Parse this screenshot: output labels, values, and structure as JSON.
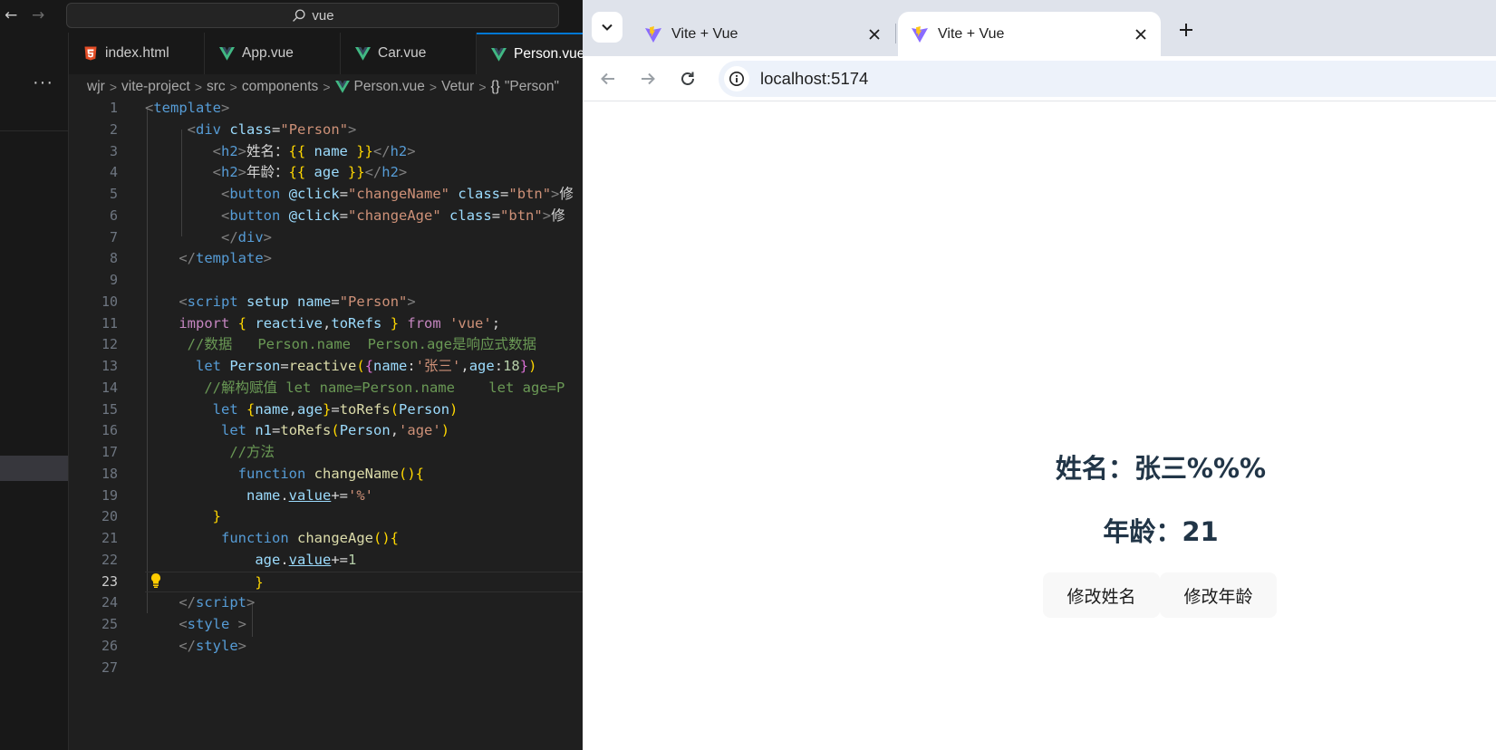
{
  "vscode": {
    "search_text": "vue",
    "more_label": "···",
    "tabs": [
      {
        "label": "index.html",
        "icon": "html5-icon"
      },
      {
        "label": "App.vue",
        "icon": "vue-icon"
      },
      {
        "label": "Car.vue",
        "icon": "vue-icon"
      },
      {
        "label": "Person.vue",
        "icon": "vue-icon",
        "active": true
      }
    ],
    "breadcrumb": [
      "wjr",
      "vite-project",
      "src",
      "components",
      "Person.vue",
      "Vetur",
      "\"Person\""
    ],
    "breadcrumb_braces": "{}",
    "line_numbers": [
      "1",
      "2",
      "3",
      "4",
      "5",
      "6",
      "7",
      "8",
      "9",
      "10",
      "11",
      "12",
      "13",
      "14",
      "15",
      "16",
      "17",
      "18",
      "19",
      "20",
      "21",
      "22",
      "23",
      "24",
      "25",
      "26",
      "27"
    ],
    "current_line": "23",
    "code": {
      "l1": {
        "lt": "<",
        "tag": "template",
        "gt": ">"
      },
      "l2": {
        "lt": "<",
        "tag": "div",
        "attr": "class",
        "eq": "=",
        "val": "\"Person\"",
        "gt": ">"
      },
      "l3": {
        "lt": "<",
        "tag": "h2",
        "gt": ">",
        "text": "姓名：",
        "ob": "{{",
        "var": "name",
        "cb": "}}",
        "close_lt": "</",
        "close_tag": "h2",
        "close_gt": ">"
      },
      "l4": {
        "lt": "<",
        "tag": "h2",
        "gt": ">",
        "text": "年龄：",
        "ob": "{{",
        "var": "age",
        "cb": "}}",
        "close_lt": "</",
        "close_tag": "h2",
        "close_gt": ">"
      },
      "l5": {
        "lt": "<",
        "tag": "button",
        "attr1": "@click",
        "eq": "=",
        "val1": "\"changeName\"",
        "attr2": "class",
        "val2": "\"btn\"",
        "gt": ">",
        "text": "修"
      },
      "l6": {
        "lt": "<",
        "tag": "button",
        "attr1": "@click",
        "eq": "=",
        "val1": "\"changeAge\"",
        "attr2": "class",
        "val2": "\"btn\"",
        "gt": ">",
        "text": "修"
      },
      "l7": {
        "lt": "</",
        "tag": "div",
        "gt": ">"
      },
      "l8": {
        "lt": "</",
        "tag": "template",
        "gt": ">"
      },
      "l10": {
        "lt": "<",
        "tag": "script",
        "attr1": "setup",
        "attr2": "name",
        "eq": "=",
        "val": "\"Person\"",
        "gt": ">"
      },
      "l11": {
        "kw": "import",
        "ob": "{",
        "id1": "reactive",
        "comma": ",",
        "id2": "toRefs",
        "cb": "}",
        "from": "from",
        "mod": "'vue'",
        "semi": ";"
      },
      "l12": {
        "comment": "//数据   Person.name  Person.age是响应式数据"
      },
      "l13": {
        "kw": "let",
        "var": "Person",
        "eq": "=",
        "fn": "reactive",
        "p1": "(",
        "b1": "{",
        "k1": "name",
        "c1": ":",
        "s1": "'张三'",
        "comma": ",",
        "k2": "age",
        "c2": ":",
        "n1": "18",
        "b2": "}",
        "p2": ")"
      },
      "l14": {
        "comment": "//解构赋值 let name=Person.name    let age=P"
      },
      "l15": {
        "kw": "let",
        "ob": "{",
        "v1": "name",
        "comma": ",",
        "v2": "age",
        "cb": "}",
        "eq": "=",
        "fn": "toRefs",
        "p1": "(",
        "arg": "Person",
        "p2": ")"
      },
      "l16": {
        "kw": "let",
        "var": "n1",
        "eq": "=",
        "fn": "toRefs",
        "p1": "(",
        "arg": "Person",
        "comma": ",",
        "s": "'age'",
        "p2": ")"
      },
      "l17": {
        "comment": "//方法"
      },
      "l18": {
        "kw": "function",
        "fn": "changeName",
        "parens": "()",
        "ob": "{"
      },
      "l19": {
        "v": "name",
        "dot": ".",
        "prop": "value",
        "op": "+=",
        "s": "'%'"
      },
      "l20": {
        "cb": "}"
      },
      "l21": {
        "kw": "function",
        "fn": "changeAge",
        "parens": "()",
        "ob": "{"
      },
      "l22": {
        "v": "age",
        "dot": ".",
        "prop": "value",
        "op": "+=",
        "n": "1"
      },
      "l23": {
        "cb": "}"
      },
      "l24": {
        "lt": "</",
        "tag": "script",
        "gt": ">"
      },
      "l25": {
        "lt": "<",
        "tag": "style",
        "gt": " >"
      },
      "l26": {
        "lt": "</",
        "tag": "style",
        "gt": ">"
      }
    }
  },
  "browser": {
    "tabs": [
      {
        "title": "Vite + Vue",
        "active": false
      },
      {
        "title": "Vite + Vue",
        "active": true
      }
    ],
    "url": "localhost:5174",
    "page": {
      "name_line": "姓名：张三%%%",
      "age_line": "年龄：21",
      "btn_change_name": "修改姓名",
      "btn_change_age": "修改年龄"
    }
  }
}
